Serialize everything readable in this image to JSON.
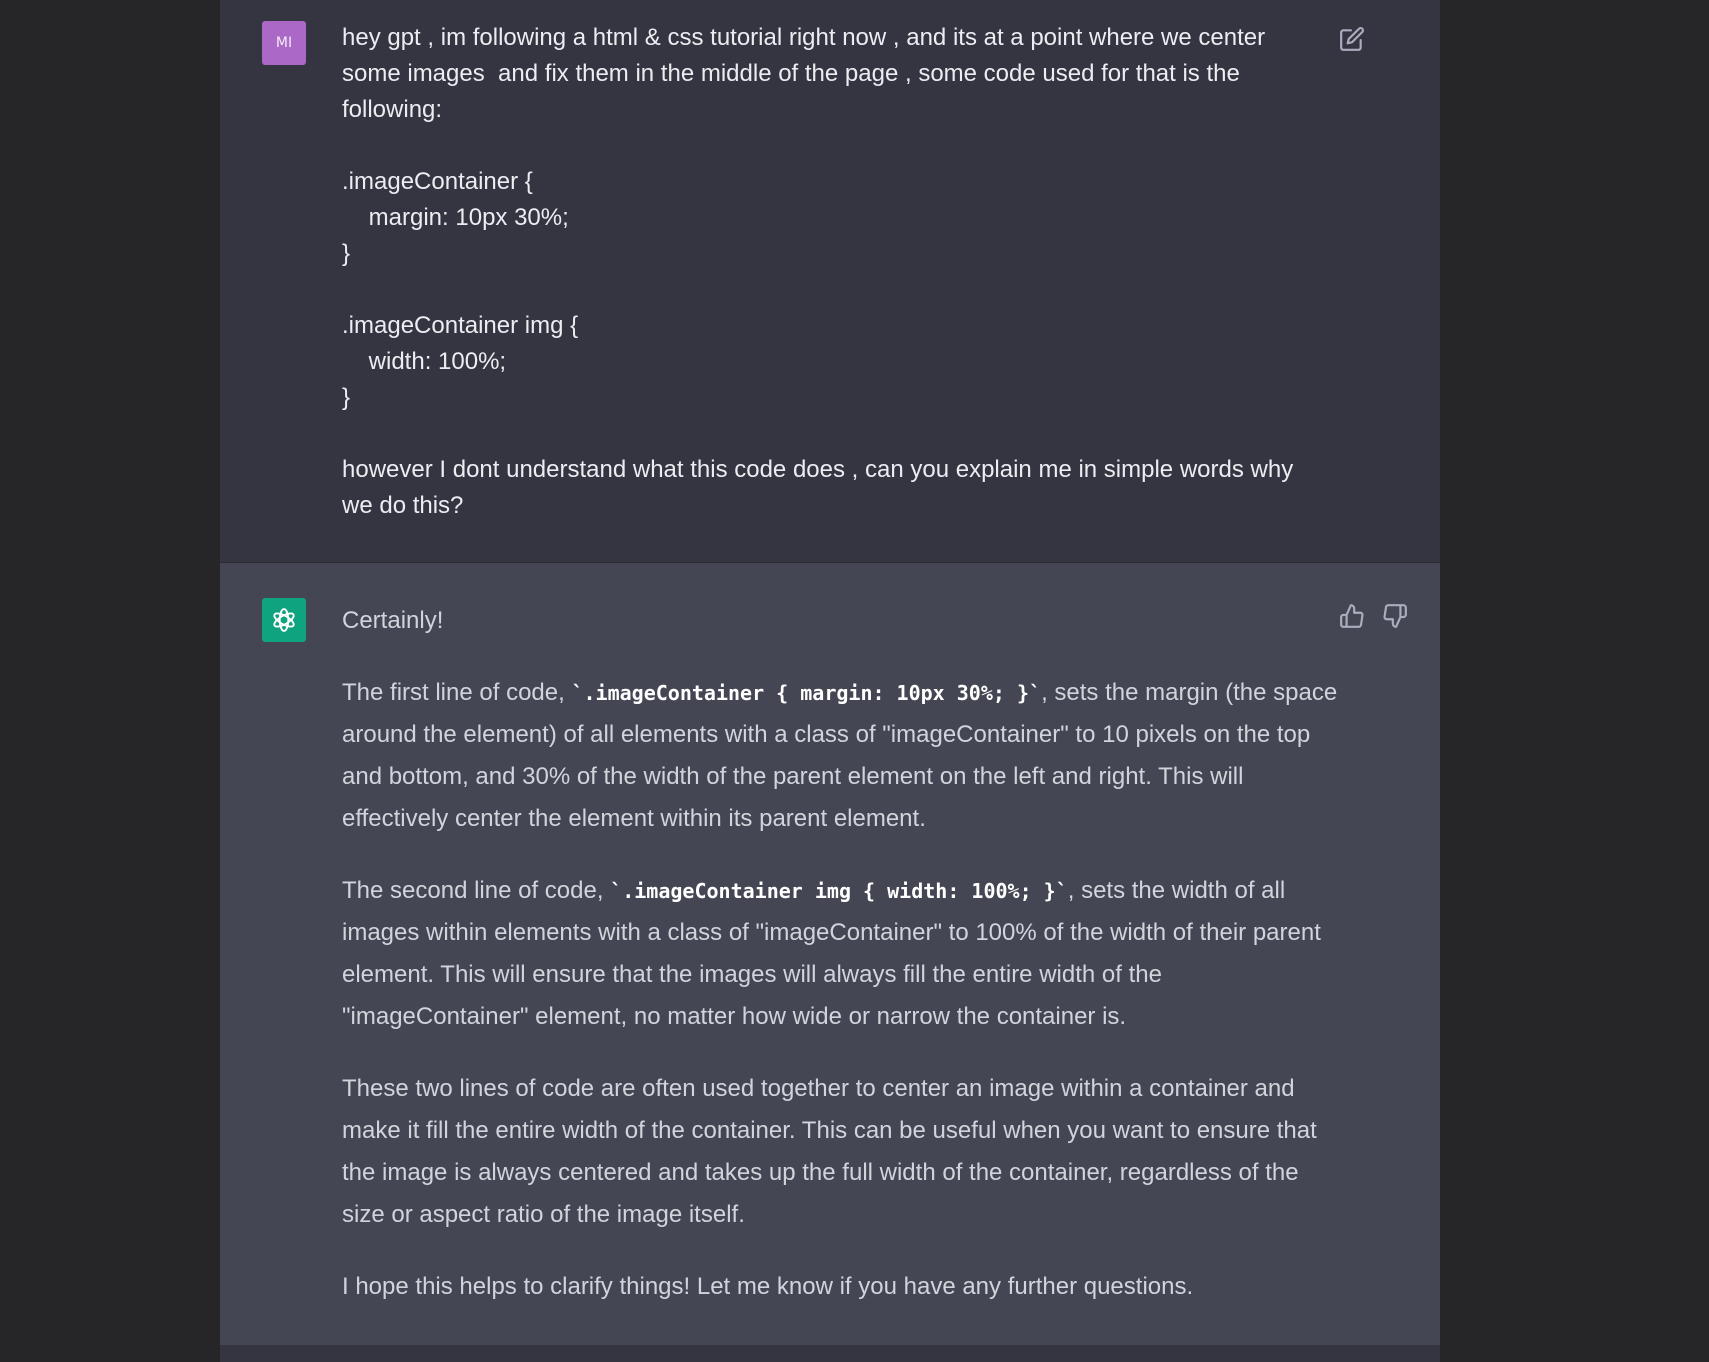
{
  "user_message": {
    "avatar_initials": "MI",
    "text": "hey gpt , im following a html & css tutorial right now , and its at a point where we center\nsome images  and fix them in the middle of the page , some code used for that is the\nfollowing:\n\n.imageContainer {\n    margin: 10px 30%;\n}\n\n.imageContainer img {\n    width: 100%;\n}\n\nhowever I dont understand what this code does , can you explain me in simple words why\nwe do this?"
  },
  "assistant_message": {
    "greeting": "Certainly!",
    "p1": {
      "before": "The first line of code, ",
      "code": "`.imageContainer { margin: 10px 30%; }`",
      "after": ", sets the margin (the space around the element) of all elements with a class of \"imageContainer\" to 10 pixels on the top and bottom, and 30% of the width of the parent element on the left and right. This will effectively center the element within its parent element."
    },
    "p2": {
      "before": "The second line of code, ",
      "code": "`.imageContainer img { width: 100%; }`",
      "after": ", sets the width of all images within elements with a class of \"imageContainer\" to 100% of the width of their parent element. This will ensure that the images will always fill the entire width of the \"imageContainer\" element, no matter how wide or narrow the container is."
    },
    "p3": "These two lines of code are often used together to center an image within a container and make it fill the entire width of the container. This can be useful when you want to ensure that the image is always centered and takes up the full width of the container, regardless of the size or aspect ratio of the image itself.",
    "p4": "I hope this helps to clarify things! Let me know if you have any further questions."
  },
  "icons": {
    "edit": "edit-icon",
    "thumbs_up": "thumbs-up-icon",
    "thumbs_down": "thumbs-down-icon",
    "openai_logo": "openai-logo-icon"
  },
  "colors": {
    "page_bg": "#262628",
    "user_bg": "#343541",
    "assistant_bg": "#444654",
    "user_avatar": "#ab68c7",
    "assistant_avatar": "#10a37f"
  }
}
